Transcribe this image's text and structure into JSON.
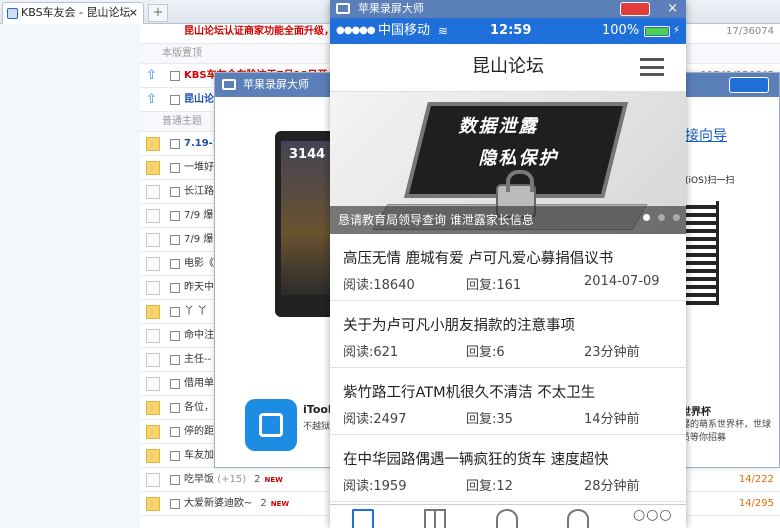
{
  "browser": {
    "tab_title": "KBS车友会 - 昆山论坛",
    "tab_close": "×",
    "new_tab": "+"
  },
  "forum": {
    "section_top": "本版置顶",
    "section_normal": "普通主题",
    "pinned": [
      {
        "title": "KBS车友会车险达于7月18日开",
        "count": "11741/156645"
      },
      {
        "title": "昆山论",
        "count": ""
      }
    ],
    "top_line": {
      "title": "昆山论坛认证商家功能全面升级，于7",
      "count": "17/36074"
    },
    "rows": [
      {
        "title": "7.19-2",
        "icon": "folder",
        "style": "blue",
        "count": ""
      },
      {
        "title": "一堆好",
        "icon": "folder",
        "style": "normal",
        "count": ""
      },
      {
        "title": "长江路",
        "icon": "doc",
        "style": "normal",
        "count": ""
      },
      {
        "title": "7/9  爆",
        "icon": "doc",
        "style": "normal",
        "count": ""
      },
      {
        "title": "7/9  爆",
        "icon": "doc",
        "style": "normal",
        "count": ""
      },
      {
        "title": "电影《",
        "icon": "doc",
        "style": "normal",
        "count": ""
      },
      {
        "title": "昨天中",
        "icon": "doc",
        "style": "normal",
        "count": ""
      },
      {
        "title": "丫 丫",
        "icon": "folder",
        "style": "normal",
        "count": ""
      },
      {
        "title": "命中注",
        "icon": "doc",
        "style": "normal",
        "count": ""
      },
      {
        "title": "主任--",
        "icon": "doc",
        "style": "normal",
        "count": ""
      },
      {
        "title": "借用单",
        "icon": "doc",
        "style": "normal",
        "count": ""
      },
      {
        "title": "各位，",
        "icon": "folder",
        "style": "normal",
        "count": ""
      },
      {
        "title": "停的距",
        "icon": "folder",
        "style": "normal",
        "count": ""
      },
      {
        "title": "车友加",
        "icon": "folder",
        "style": "normal",
        "count": ""
      },
      {
        "title": "吃早饭",
        "icon": "doc",
        "style": "normal",
        "extra": "(+15)",
        "num": "2",
        "count": "14/222"
      },
      {
        "title": "大爱新婆迪欧~",
        "icon": "folder",
        "style": "normal",
        "num": "2",
        "count": "14/295"
      }
    ],
    "new_badge": "NEW"
  },
  "bgwindow": {
    "title": "苹果录屏大师",
    "device_number": "3144",
    "help_link": "接向导",
    "scan_text": "(iOS)扫一扫",
    "app_name": "iTool",
    "app_sub": "不越狱",
    "cup_title": "世界杯",
    "cup_desc": "爆的萌系世界杯，世球员等你招募"
  },
  "phone": {
    "recorder_title": "苹果录屏大师",
    "recorder_close": "×",
    "status": {
      "signal": "●●●●●",
      "carrier": "中国移动",
      "wifi": "≋",
      "time": "12:59",
      "battery": "100%",
      "bolt": "⚡"
    },
    "nav_title": "昆山论坛",
    "banner": {
      "line1": "数据泄露",
      "line2": "隐私保护",
      "caption": "恳请教育局领导查询  谁泄露家长信息"
    },
    "posts": [
      {
        "title": "高压无情 鹿城有爱 卢可凡爱心募捐倡议书",
        "views": "阅读:18640",
        "replies": "回复:161",
        "time": "2014-07-09"
      },
      {
        "title": "关于为卢可凡小朋友捐款的注意事项",
        "views": "阅读:621",
        "replies": "回复:6",
        "time": "23分钟前"
      },
      {
        "title": "紫竹路工行ATM机很久不清洁 不太卫生",
        "views": "阅读:2497",
        "replies": "回复:35",
        "time": "14分钟前"
      },
      {
        "title": "在中华园路偶遇一辆疯狂的货车 速度超快",
        "views": "阅读:1959",
        "replies": "回复:12",
        "time": "28分钟前"
      }
    ],
    "more_icon": "○○○"
  }
}
